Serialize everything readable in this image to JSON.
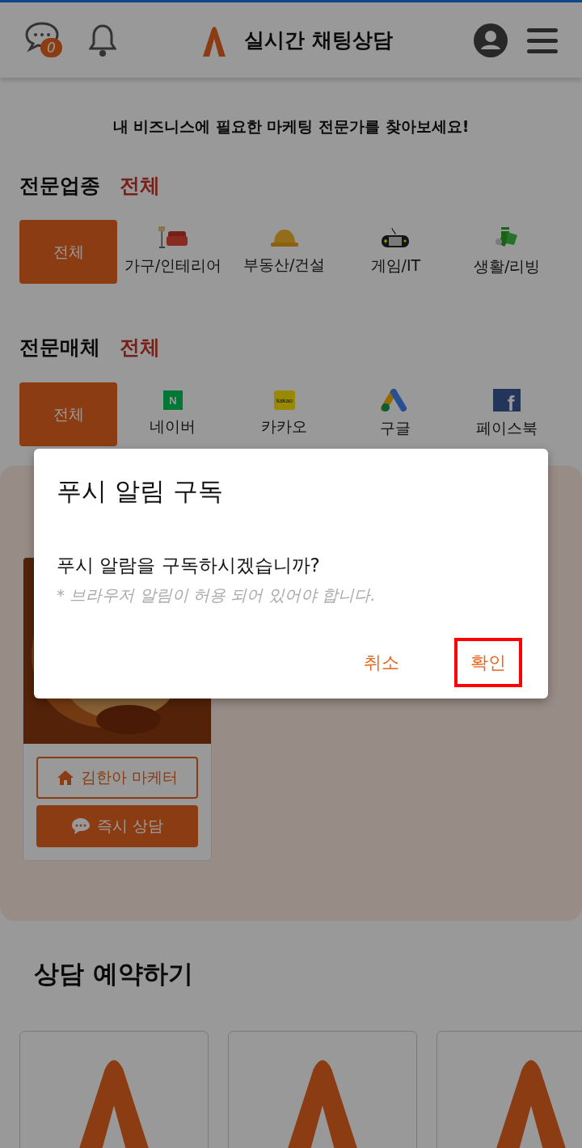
{
  "header": {
    "chat_badge": "0",
    "title": "실시간 채팅상담"
  },
  "tagline": "내 비즈니스에 필요한 마케팅 전문가를 찾아보세요!",
  "filters": [
    {
      "label": "전문업종",
      "current": "전체",
      "options": [
        {
          "label": "전체",
          "kind": "all",
          "selected": true
        },
        {
          "label": "가구/인테리어",
          "kind": "furniture",
          "selected": false
        },
        {
          "label": "부동산/건설",
          "kind": "helmet",
          "selected": false
        },
        {
          "label": "게임/IT",
          "kind": "console",
          "selected": false
        },
        {
          "label": "생활/리빙",
          "kind": "socks",
          "selected": false
        }
      ]
    },
    {
      "label": "전문매체",
      "current": "전체",
      "options": [
        {
          "label": "전체",
          "kind": "all",
          "selected": true
        },
        {
          "label": "네이버",
          "kind": "naver",
          "icon_text": "N",
          "selected": false
        },
        {
          "label": "카카오",
          "kind": "kakao",
          "icon_text": "kakao",
          "selected": false
        },
        {
          "label": "구글",
          "kind": "google",
          "selected": false
        },
        {
          "label": "페이스북",
          "kind": "facebook",
          "icon_text": "f",
          "selected": false
        }
      ]
    }
  ],
  "featured": {
    "card": {
      "kind": "picture",
      "profile_button": "김한아 마케터",
      "chat_button": "즉시 상담"
    }
  },
  "booking": {
    "title": "상담 예약하기",
    "cards": [
      {
        "kind": "logo"
      },
      {
        "kind": "logo"
      },
      {
        "kind": "logo"
      }
    ]
  },
  "dialog": {
    "title": "푸시 알림 구독",
    "message": "푸시 알람을 구독하시겠습니까?",
    "note": "* 브라우저 알림이 허용 되어 있어야 합니다.",
    "buttons": [
      {
        "label": "취소",
        "highlighted": false
      },
      {
        "label": "확인",
        "highlighted": true
      }
    ]
  }
}
